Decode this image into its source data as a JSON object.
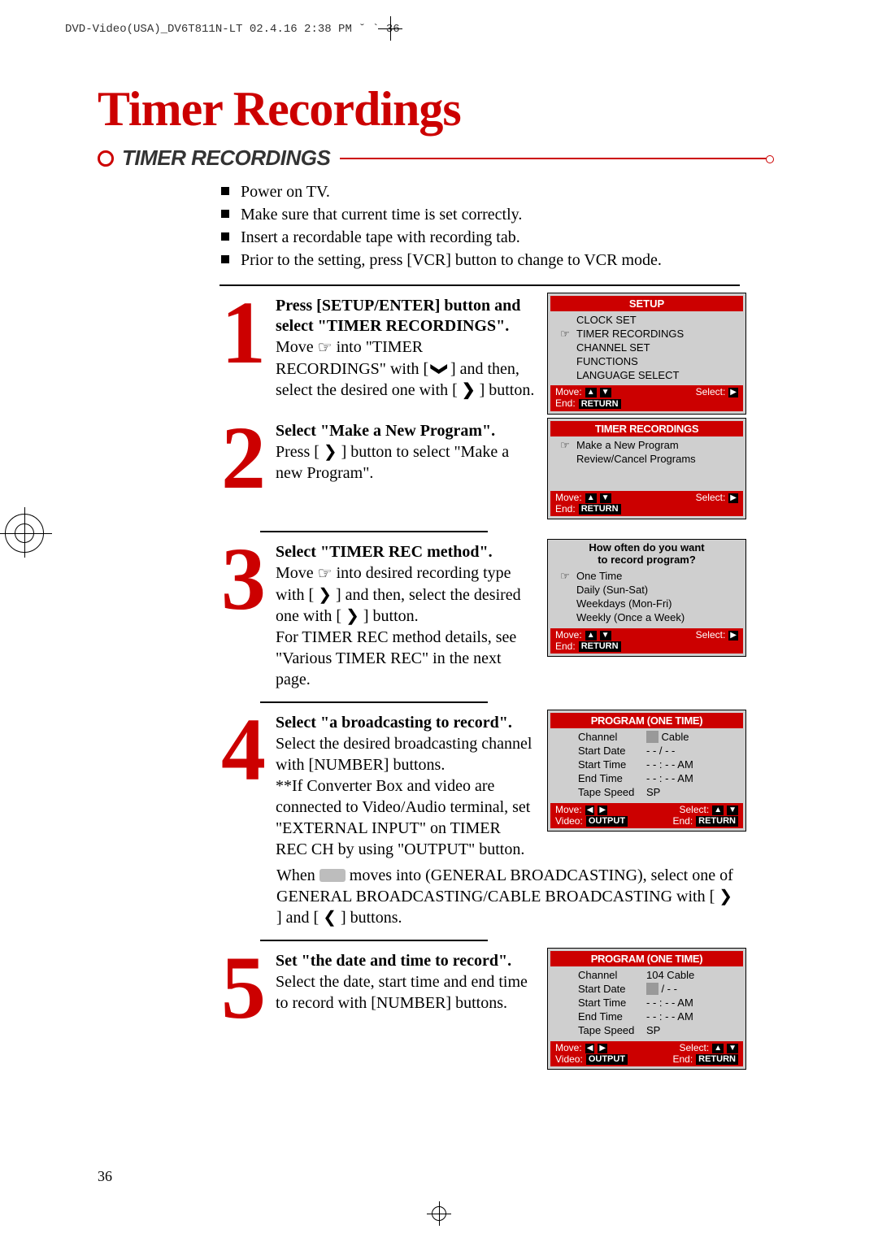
{
  "meta": {
    "header_stamp": "DVD-Video(USA)_DV6T811N-LT 02.4.16 2:38 PM ˘ ` 36",
    "page_number": "36"
  },
  "title": "Timer Recordings",
  "section_heading": "TIMER RECORDINGS",
  "pre_steps": [
    "Power on TV.",
    "Make sure that current time is set correctly.",
    "Insert a recordable tape with recording tab.",
    "Prior to the setting, press [VCR] button to change to VCR mode."
  ],
  "steps": [
    {
      "num": "1",
      "bold": "Press [SETUP/ENTER] button and select \"TIMER RECORDINGS\".",
      "body_parts": {
        "p1a": "Move  ",
        "p1b": "  into \"TIMER RECORDINGS\" with [ ",
        "sym1": "❯",
        "p1c": " ] and then, select the desired one with [ ",
        "sym2": "❯",
        "p1d": " ] button."
      }
    },
    {
      "num": "2",
      "bold": "Select \"Make a New Program\".",
      "body": "Press [ ❯ ] button to select \"Make a new Program\"."
    },
    {
      "num": "3",
      "bold": "Select \"TIMER REC method\".",
      "body_parts": {
        "a": "Move  ",
        "b": "  into desired recording type with [ ❯ ] and then, select the desired one with [ ❯ ] button.",
        "c": "For TIMER REC method details, see \"Various TIMER REC\" in the next page."
      }
    },
    {
      "num": "4",
      "bold": "Select \"a broadcasting to record\".",
      "body": "Select the desired broadcasting channel with [NUMBER] buttons.",
      "note": "**If Converter Box and video are connected to Video/Audio terminal, set \"EXTERNAL INPUT\" on TIMER REC CH by using \"OUTPUT\" button.",
      "after_parts": {
        "a": "When  ",
        "b": "  moves into (GENERAL BROADCASTING), select one of GENERAL BROADCASTING/CABLE BROADCASTING with [ ❯ ] and [ ❮ ] buttons."
      }
    },
    {
      "num": "5",
      "bold": "Set \"the date and time to record\".",
      "body": "Select the date, start time and end time to record with [NUMBER] buttons."
    }
  ],
  "osd1": {
    "title": "SETUP",
    "items": [
      "CLOCK SET",
      "TIMER RECORDINGS",
      "CHANNEL SET",
      "FUNCTIONS",
      "LANGUAGE SELECT"
    ],
    "selected_index": 1,
    "footer": {
      "move": "Move:",
      "select": "Select:",
      "end": "End:",
      "return": "RETURN"
    }
  },
  "osd2": {
    "title": "TIMER RECORDINGS",
    "items": [
      "Make a New Program",
      "Review/Cancel Programs"
    ],
    "selected_index": 0,
    "footer": {
      "move": "Move:",
      "select": "Select:",
      "end": "End:",
      "return": "RETURN"
    }
  },
  "osd3": {
    "prompt1": "How often do you want",
    "prompt2": "to record program?",
    "items": [
      "One Time",
      "Daily (Sun-Sat)",
      "Weekdays (Mon-Fri)",
      "Weekly (Once a Week)"
    ],
    "selected_index": 0,
    "footer": {
      "move": "Move:",
      "select": "Select:",
      "end": "End:",
      "return": "RETURN"
    }
  },
  "osd4": {
    "title": "PROGRAM (ONE TIME)",
    "rows": {
      "Channel": "Cable",
      "Start Date": "- - / - -",
      "Start Time": "- - : - - AM",
      "End Time": "- - : - - AM",
      "Tape Speed": "SP"
    },
    "highlight_key": "Channel",
    "footer": {
      "move": "Move:",
      "select": "Select:",
      "video": "Video:",
      "output": "OUTPUT",
      "end": "End:",
      "return": "RETURN"
    }
  },
  "osd5": {
    "title": "PROGRAM (ONE TIME)",
    "rows": {
      "Channel": "104 Cable",
      "Start Date": "- - / - -",
      "Start Time": "- - : - - AM",
      "End Time": "- - : - - AM",
      "Tape Speed": "SP"
    },
    "highlight_key": "Start Date",
    "footer": {
      "move": "Move:",
      "select": "Select:",
      "video": "Video:",
      "output": "OUTPUT",
      "end": "End:",
      "return": "RETURN"
    }
  },
  "icons": {
    "hand": "☞",
    "up": "▲",
    "down": "▼",
    "right": "▶",
    "left": "◀"
  }
}
